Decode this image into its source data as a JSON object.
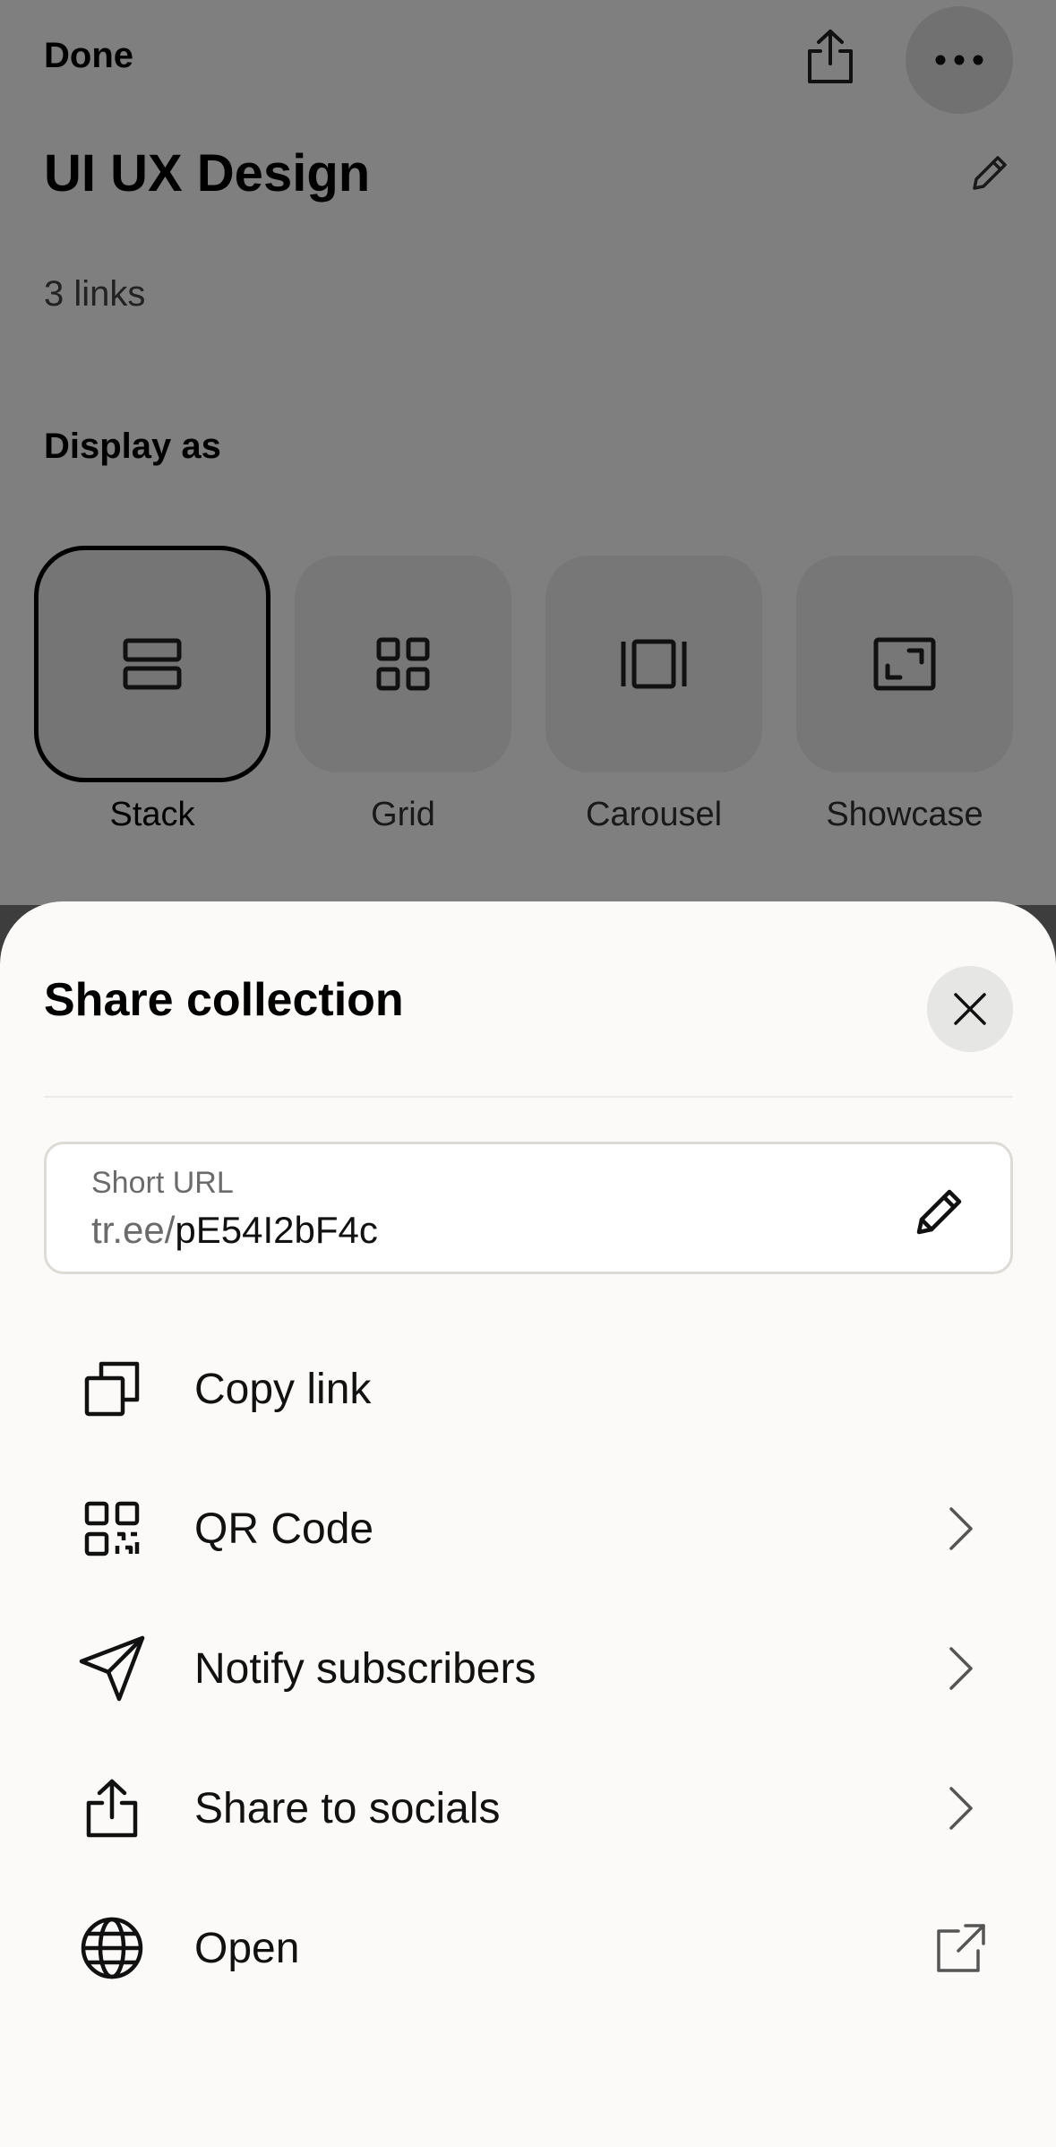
{
  "header": {
    "done_label": "Done"
  },
  "collection": {
    "title": "UI UX Design",
    "link_count": "3 links"
  },
  "display": {
    "heading": "Display as",
    "selected": "Stack",
    "options": [
      {
        "label": "Stack",
        "icon": "stack-icon"
      },
      {
        "label": "Grid",
        "icon": "grid-icon"
      },
      {
        "label": "Carousel",
        "icon": "carousel-icon"
      },
      {
        "label": "Showcase",
        "icon": "showcase-icon"
      }
    ]
  },
  "sheet": {
    "title": "Share collection",
    "short_url": {
      "label": "Short URL",
      "prefix": "tr.ee/",
      "slug": "pE54I2bF4c"
    },
    "items": [
      {
        "label": "Copy link",
        "icon": "copy-icon",
        "trailing": ""
      },
      {
        "label": "QR Code",
        "icon": "qr-code-icon",
        "trailing": "chevron-right-icon"
      },
      {
        "label": "Notify subscribers",
        "icon": "send-icon",
        "trailing": "chevron-right-icon"
      },
      {
        "label": "Share to socials",
        "icon": "share-icon",
        "trailing": "chevron-right-icon"
      },
      {
        "label": "Open",
        "icon": "globe-icon",
        "trailing": "external-link-icon"
      }
    ]
  },
  "colors": {
    "sheet_background": "#fbfaf8",
    "overlay": "rgba(0,0,0,0.5)",
    "field_border": "#dcdbd6"
  }
}
